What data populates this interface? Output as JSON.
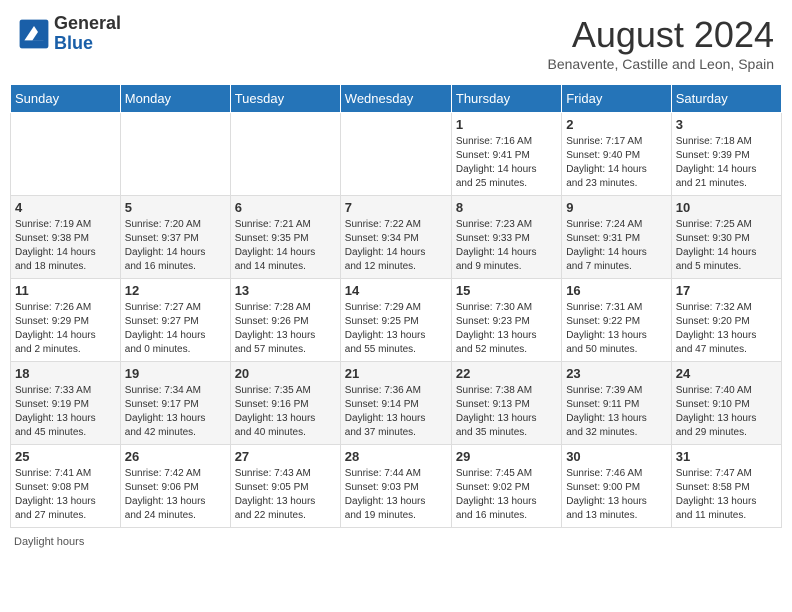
{
  "header": {
    "logo_general": "General",
    "logo_blue": "Blue",
    "month_year": "August 2024",
    "location": "Benavente, Castille and Leon, Spain"
  },
  "days_of_week": [
    "Sunday",
    "Monday",
    "Tuesday",
    "Wednesday",
    "Thursday",
    "Friday",
    "Saturday"
  ],
  "weeks": [
    [
      {
        "day": "",
        "info": ""
      },
      {
        "day": "",
        "info": ""
      },
      {
        "day": "",
        "info": ""
      },
      {
        "day": "",
        "info": ""
      },
      {
        "day": "1",
        "info": "Sunrise: 7:16 AM\nSunset: 9:41 PM\nDaylight: 14 hours\nand 25 minutes."
      },
      {
        "day": "2",
        "info": "Sunrise: 7:17 AM\nSunset: 9:40 PM\nDaylight: 14 hours\nand 23 minutes."
      },
      {
        "day": "3",
        "info": "Sunrise: 7:18 AM\nSunset: 9:39 PM\nDaylight: 14 hours\nand 21 minutes."
      }
    ],
    [
      {
        "day": "4",
        "info": "Sunrise: 7:19 AM\nSunset: 9:38 PM\nDaylight: 14 hours\nand 18 minutes."
      },
      {
        "day": "5",
        "info": "Sunrise: 7:20 AM\nSunset: 9:37 PM\nDaylight: 14 hours\nand 16 minutes."
      },
      {
        "day": "6",
        "info": "Sunrise: 7:21 AM\nSunset: 9:35 PM\nDaylight: 14 hours\nand 14 minutes."
      },
      {
        "day": "7",
        "info": "Sunrise: 7:22 AM\nSunset: 9:34 PM\nDaylight: 14 hours\nand 12 minutes."
      },
      {
        "day": "8",
        "info": "Sunrise: 7:23 AM\nSunset: 9:33 PM\nDaylight: 14 hours\nand 9 minutes."
      },
      {
        "day": "9",
        "info": "Sunrise: 7:24 AM\nSunset: 9:31 PM\nDaylight: 14 hours\nand 7 minutes."
      },
      {
        "day": "10",
        "info": "Sunrise: 7:25 AM\nSunset: 9:30 PM\nDaylight: 14 hours\nand 5 minutes."
      }
    ],
    [
      {
        "day": "11",
        "info": "Sunrise: 7:26 AM\nSunset: 9:29 PM\nDaylight: 14 hours\nand 2 minutes."
      },
      {
        "day": "12",
        "info": "Sunrise: 7:27 AM\nSunset: 9:27 PM\nDaylight: 14 hours\nand 0 minutes."
      },
      {
        "day": "13",
        "info": "Sunrise: 7:28 AM\nSunset: 9:26 PM\nDaylight: 13 hours\nand 57 minutes."
      },
      {
        "day": "14",
        "info": "Sunrise: 7:29 AM\nSunset: 9:25 PM\nDaylight: 13 hours\nand 55 minutes."
      },
      {
        "day": "15",
        "info": "Sunrise: 7:30 AM\nSunset: 9:23 PM\nDaylight: 13 hours\nand 52 minutes."
      },
      {
        "day": "16",
        "info": "Sunrise: 7:31 AM\nSunset: 9:22 PM\nDaylight: 13 hours\nand 50 minutes."
      },
      {
        "day": "17",
        "info": "Sunrise: 7:32 AM\nSunset: 9:20 PM\nDaylight: 13 hours\nand 47 minutes."
      }
    ],
    [
      {
        "day": "18",
        "info": "Sunrise: 7:33 AM\nSunset: 9:19 PM\nDaylight: 13 hours\nand 45 minutes."
      },
      {
        "day": "19",
        "info": "Sunrise: 7:34 AM\nSunset: 9:17 PM\nDaylight: 13 hours\nand 42 minutes."
      },
      {
        "day": "20",
        "info": "Sunrise: 7:35 AM\nSunset: 9:16 PM\nDaylight: 13 hours\nand 40 minutes."
      },
      {
        "day": "21",
        "info": "Sunrise: 7:36 AM\nSunset: 9:14 PM\nDaylight: 13 hours\nand 37 minutes."
      },
      {
        "day": "22",
        "info": "Sunrise: 7:38 AM\nSunset: 9:13 PM\nDaylight: 13 hours\nand 35 minutes."
      },
      {
        "day": "23",
        "info": "Sunrise: 7:39 AM\nSunset: 9:11 PM\nDaylight: 13 hours\nand 32 minutes."
      },
      {
        "day": "24",
        "info": "Sunrise: 7:40 AM\nSunset: 9:10 PM\nDaylight: 13 hours\nand 29 minutes."
      }
    ],
    [
      {
        "day": "25",
        "info": "Sunrise: 7:41 AM\nSunset: 9:08 PM\nDaylight: 13 hours\nand 27 minutes."
      },
      {
        "day": "26",
        "info": "Sunrise: 7:42 AM\nSunset: 9:06 PM\nDaylight: 13 hours\nand 24 minutes."
      },
      {
        "day": "27",
        "info": "Sunrise: 7:43 AM\nSunset: 9:05 PM\nDaylight: 13 hours\nand 22 minutes."
      },
      {
        "day": "28",
        "info": "Sunrise: 7:44 AM\nSunset: 9:03 PM\nDaylight: 13 hours\nand 19 minutes."
      },
      {
        "day": "29",
        "info": "Sunrise: 7:45 AM\nSunset: 9:02 PM\nDaylight: 13 hours\nand 16 minutes."
      },
      {
        "day": "30",
        "info": "Sunrise: 7:46 AM\nSunset: 9:00 PM\nDaylight: 13 hours\nand 13 minutes."
      },
      {
        "day": "31",
        "info": "Sunrise: 7:47 AM\nSunset: 8:58 PM\nDaylight: 13 hours\nand 11 minutes."
      }
    ]
  ],
  "footer": "Daylight hours"
}
